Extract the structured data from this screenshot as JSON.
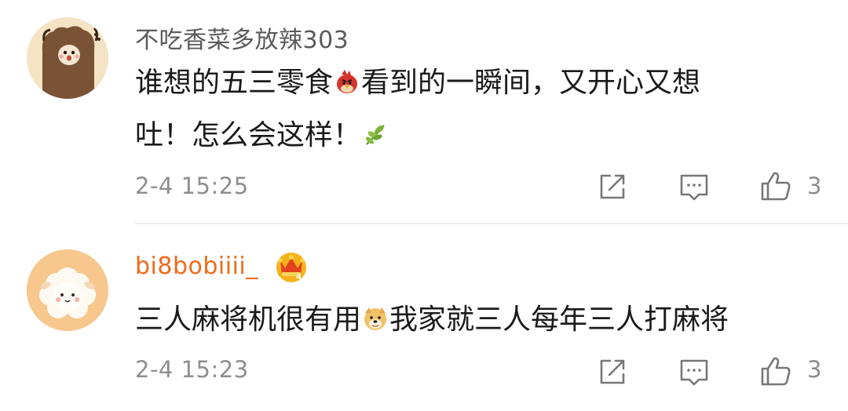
{
  "comments": [
    {
      "avatar": "alpaca-avatar-icon",
      "username": "不吃香菜多放辣303",
      "text_line1_a": "谁想的五三零食",
      "emoji1": "angry-bird-emoji-icon",
      "text_line1_b": "看到的一瞬间，又开心又想",
      "text_line2": "吐！怎么会这样！",
      "emoji2": "leaf-emoji-icon",
      "time": "2-4 15:25",
      "likes": "3"
    },
    {
      "avatar": "sheep-avatar-icon",
      "username": "bi8bobiiii_",
      "badge": "crown-vip-icon",
      "text_a": "三人麻将机很有用",
      "emoji": "doge-emoji-icon",
      "text_b": "我家就三人每年三人打麻将",
      "time": "2-4 15:23",
      "likes": "3"
    }
  ],
  "actions": [
    "share-icon",
    "reply-icon",
    "like-icon"
  ],
  "colors": {
    "username_default": "#5a5a5a",
    "username_vip": "#ef6a18",
    "meta": "#8e8e8e",
    "text": "#1a1a1a",
    "divider": "#ececec"
  }
}
